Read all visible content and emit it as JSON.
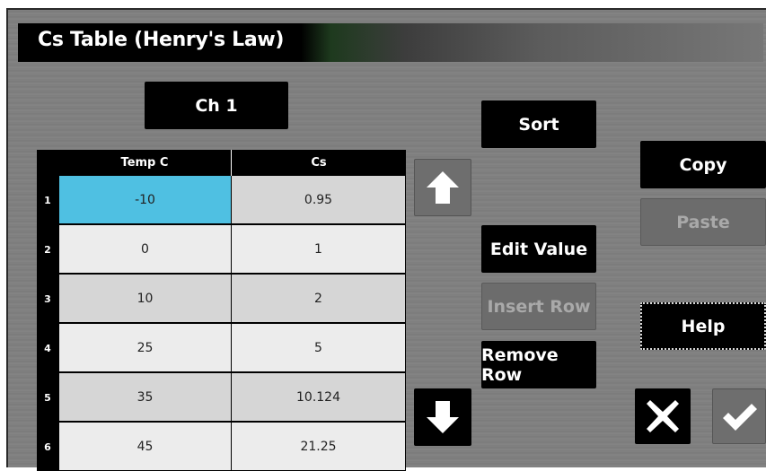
{
  "window": {
    "title": "Cs Table (Henry's Law)"
  },
  "channel_button": "Ch 1",
  "table": {
    "columns": [
      "Temp C",
      "Cs"
    ],
    "rows": [
      {
        "num": "1",
        "temp": "-10",
        "cs": "0.95",
        "selected": true
      },
      {
        "num": "2",
        "temp": "0",
        "cs": "1"
      },
      {
        "num": "3",
        "temp": "10",
        "cs": "2"
      },
      {
        "num": "4",
        "temp": "25",
        "cs": "5"
      },
      {
        "num": "5",
        "temp": "35",
        "cs": "10.124"
      },
      {
        "num": "6",
        "temp": "45",
        "cs": "21.25"
      }
    ],
    "selected_color": "#4fc0e2"
  },
  "buttons": {
    "sort": "Sort",
    "copy": "Copy",
    "paste": "Paste",
    "edit_value": "Edit Value",
    "insert_row": "Insert Row",
    "remove_row": "Remove Row",
    "help": "Help"
  },
  "icons": {
    "scroll_up": "arrow-up-icon",
    "scroll_down": "arrow-down-icon",
    "cancel": "close-icon",
    "confirm": "checkmark-icon"
  },
  "states": {
    "paste_enabled": false,
    "insert_row_enabled": false,
    "scroll_up_enabled": false,
    "confirm_enabled": false
  }
}
